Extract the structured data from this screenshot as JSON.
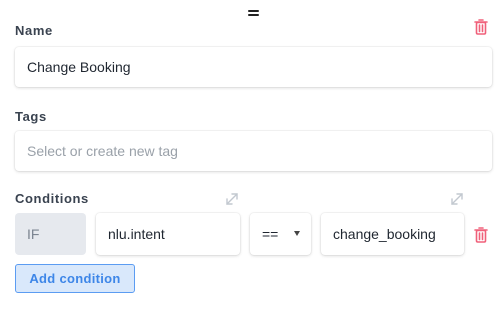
{
  "name": {
    "label": "Name",
    "value": "Change Booking"
  },
  "tags": {
    "label": "Tags",
    "placeholder": "Select or create new tag"
  },
  "conditions": {
    "label": "Conditions",
    "row": {
      "if_label": "IF",
      "field": "nlu.intent",
      "operator": "==",
      "value": "change_booking"
    },
    "add_button": "Add condition"
  },
  "colors": {
    "delete": "#f0607a",
    "accent": "#3d86e8",
    "expand": "#c2c8cf"
  },
  "icons": [
    "drag-handle-icon",
    "trash-icon",
    "expand-icon",
    "caret-down-icon"
  ]
}
